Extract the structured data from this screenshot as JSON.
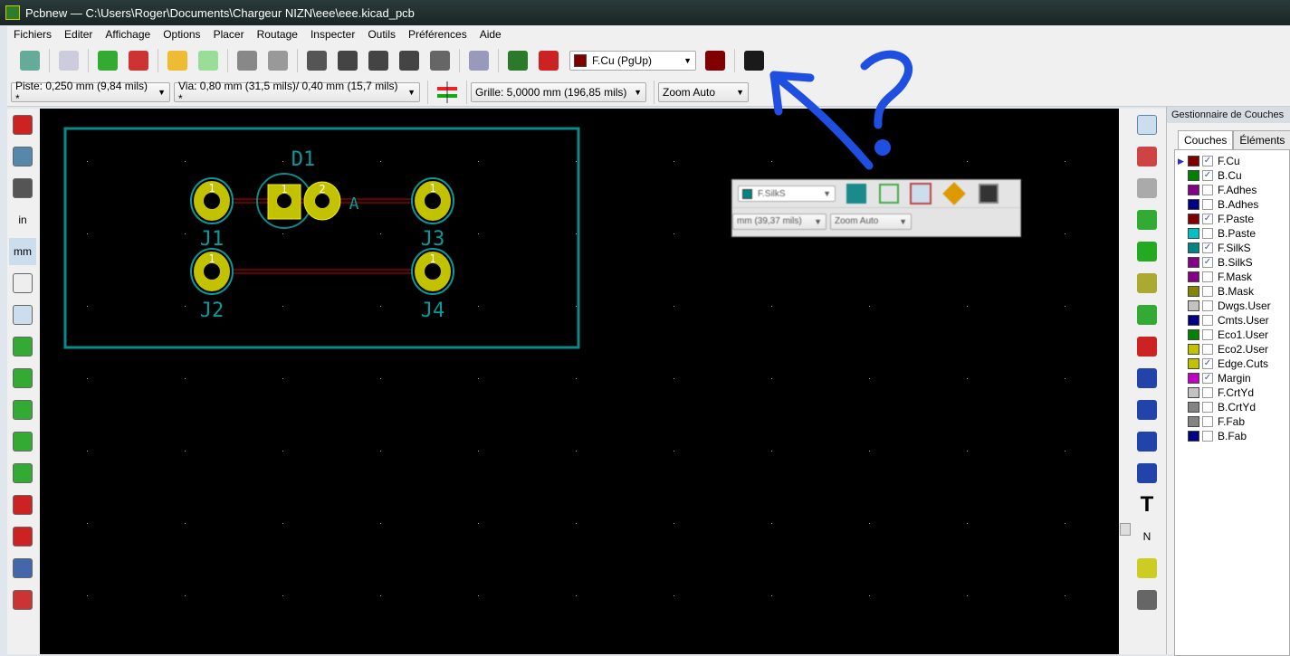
{
  "window": {
    "title": "Pcbnew — C:\\Users\\Roger\\Documents\\Chargeur NIZN\\eee\\eee.kicad_pcb"
  },
  "menu": [
    "Fichiers",
    "Editer",
    "Affichage",
    "Options",
    "Placer",
    "Routage",
    "Inspecter",
    "Outils",
    "Préférences",
    "Aide"
  ],
  "toolbar_top": [
    {
      "name": "save-board-icon",
      "color": "#6a9"
    },
    {
      "sep": true
    },
    {
      "name": "page-settings-icon",
      "color": "#ccd"
    },
    {
      "sep": true
    },
    {
      "name": "footprint-editor-icon",
      "color": "#3a3"
    },
    {
      "name": "footprint-viewer-icon",
      "color": "#c33"
    },
    {
      "sep": true
    },
    {
      "name": "undo-icon",
      "color": "#eb3"
    },
    {
      "name": "redo-icon",
      "color": "#9d9"
    },
    {
      "sep": true
    },
    {
      "name": "print-icon",
      "color": "#888"
    },
    {
      "name": "plot-icon",
      "color": "#999"
    },
    {
      "sep": true
    },
    {
      "name": "redraw-icon",
      "color": "#555"
    },
    {
      "name": "zoom-in-icon",
      "color": "#444"
    },
    {
      "name": "zoom-out-icon",
      "color": "#444"
    },
    {
      "name": "zoom-fit-icon",
      "color": "#444"
    },
    {
      "name": "zoom-selection-icon",
      "color": "#666"
    },
    {
      "sep": true
    },
    {
      "name": "find-icon",
      "color": "#99b"
    },
    {
      "sep": true
    },
    {
      "name": "netlist-icon",
      "color": "#2a7a2a"
    },
    {
      "name": "drc-ladybug-icon",
      "color": "#c22"
    }
  ],
  "layer_select": {
    "value": "F.Cu (PgUp)",
    "swatch": "#800000"
  },
  "toolbar_top2": [
    {
      "name": "layer-pair-icon",
      "color": "#800000"
    },
    {
      "sep": true
    },
    {
      "name": "scripting-console-icon",
      "color": "#1a1a1a"
    }
  ],
  "track_width": "Piste: 0,250 mm (9,84 mils) *",
  "via_size": "Via: 0,80 mm (31,5 mils)/ 0,40 mm (15,7 mils) *",
  "grid": "Grille: 5,0000 mm (196,85 mils)",
  "zoom": "Zoom Auto",
  "left_tools": [
    "drc-off-icon",
    "grid-icon",
    "polar-coords-icon",
    "units-inch-icon",
    "units-mm-icon",
    "cursor-shape-icon",
    "ratsnest-icon",
    "auto-delete-track-icon",
    "show-zones-icon",
    "zone-outline-icon",
    "pad-sketch-icon",
    "via-sketch-icon",
    "track-sketch-icon",
    "high-contrast-icon",
    "layers-manager-icon",
    "microwave-icon"
  ],
  "left_labels": {
    "in": "in",
    "mm": "mm"
  },
  "right_tools": [
    "select-icon",
    "highlight-net-icon",
    "local-ratsnest-icon",
    "add-footprint-icon",
    "add-track-icon",
    "add-via-icon",
    "add-zone-icon",
    "add-keepout-icon",
    "add-line-icon",
    "add-circle-icon",
    "add-arc-icon",
    "add-polygon-icon",
    "add-text-icon",
    "add-dimension-icon",
    "place-anchor-icon",
    "delete-icon"
  ],
  "right_labels": {
    "text": "T",
    "dimension": "N"
  },
  "layers_panel": {
    "title": "Gestionnaire de Couches",
    "tabs": [
      "Couches",
      "Éléments"
    ],
    "layers": [
      {
        "name": "F.Cu",
        "color": "#800000",
        "checked": true,
        "current": true
      },
      {
        "name": "B.Cu",
        "color": "#008000",
        "checked": true
      },
      {
        "name": "F.Adhes",
        "color": "#840084",
        "checked": false
      },
      {
        "name": "B.Adhes",
        "color": "#000084",
        "checked": false
      },
      {
        "name": "F.Paste",
        "color": "#800000",
        "checked": true
      },
      {
        "name": "B.Paste",
        "color": "#00c2c2",
        "checked": false
      },
      {
        "name": "F.SilkS",
        "color": "#008484",
        "checked": true
      },
      {
        "name": "B.SilkS",
        "color": "#840084",
        "checked": true
      },
      {
        "name": "F.Mask",
        "color": "#840084",
        "checked": false
      },
      {
        "name": "B.Mask",
        "color": "#848400",
        "checked": false
      },
      {
        "name": "Dwgs.User",
        "color": "#c2c2c2",
        "checked": false
      },
      {
        "name": "Cmts.User",
        "color": "#000084",
        "checked": false
      },
      {
        "name": "Eco1.User",
        "color": "#008400",
        "checked": false
      },
      {
        "name": "Eco2.User",
        "color": "#c2c200",
        "checked": false
      },
      {
        "name": "Edge.Cuts",
        "color": "#c2c200",
        "checked": true
      },
      {
        "name": "Margin",
        "color": "#c200c2",
        "checked": true
      },
      {
        "name": "F.CrtYd",
        "color": "#c2c2c2",
        "checked": false
      },
      {
        "name": "B.CrtYd",
        "color": "#848484",
        "checked": false
      },
      {
        "name": "F.Fab",
        "color": "#848484",
        "checked": false
      },
      {
        "name": "B.Fab",
        "color": "#000084",
        "checked": false
      }
    ]
  },
  "pcb": {
    "refs": {
      "d1": "D1",
      "j1": "J1",
      "j2": "J2",
      "j3": "J3",
      "j4": "J4",
      "anode": "A"
    },
    "pad_number_1": "1",
    "pad_number_2": "2"
  },
  "overlay": {
    "layer": "F.SilkS",
    "grid": "mm (39,37 mils)",
    "zoom": "Zoom Auto"
  },
  "annotation": {
    "mark": "?"
  }
}
